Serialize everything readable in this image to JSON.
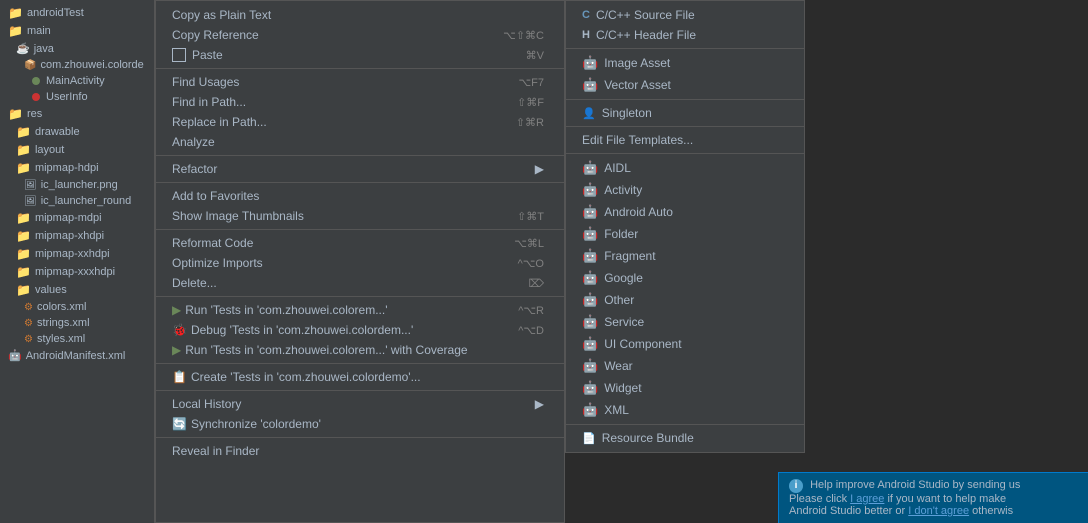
{
  "sidebar": {
    "items": [
      {
        "label": "androidTest",
        "indent": 0,
        "type": "folder"
      },
      {
        "label": "main",
        "indent": 0,
        "type": "folder"
      },
      {
        "label": "java",
        "indent": 1,
        "type": "folder"
      },
      {
        "label": "com.zhouwei.colorde",
        "indent": 2,
        "type": "package"
      },
      {
        "label": "MainActivity",
        "indent": 3,
        "type": "class-green"
      },
      {
        "label": "UserInfo",
        "indent": 3,
        "type": "class-red"
      },
      {
        "label": "res",
        "indent": 0,
        "type": "folder"
      },
      {
        "label": "drawable",
        "indent": 1,
        "type": "folder"
      },
      {
        "label": "layout",
        "indent": 1,
        "type": "folder"
      },
      {
        "label": "mipmap-hdpi",
        "indent": 1,
        "type": "folder"
      },
      {
        "label": "ic_launcher.png",
        "indent": 2,
        "type": "file"
      },
      {
        "label": "ic_launcher_round",
        "indent": 2,
        "type": "file"
      },
      {
        "label": "mipmap-mdpi",
        "indent": 1,
        "type": "folder"
      },
      {
        "label": "mipmap-xhdpi",
        "indent": 1,
        "type": "folder"
      },
      {
        "label": "mipmap-xxhdpi",
        "indent": 1,
        "type": "folder"
      },
      {
        "label": "mipmap-xxxhdpi",
        "indent": 1,
        "type": "folder"
      },
      {
        "label": "values",
        "indent": 1,
        "type": "folder"
      },
      {
        "label": "colors.xml",
        "indent": 2,
        "type": "xml"
      },
      {
        "label": "strings.xml",
        "indent": 2,
        "type": "xml"
      },
      {
        "label": "styles.xml",
        "indent": 2,
        "type": "xml"
      },
      {
        "label": "AndroidManifest.xml",
        "indent": 0,
        "type": "android"
      }
    ]
  },
  "left_menu": {
    "items": [
      {
        "label": "Copy as Plain Text",
        "shortcut": "",
        "type": "item"
      },
      {
        "label": "Copy Reference",
        "shortcut": "⌥⇧⌘C",
        "type": "item"
      },
      {
        "label": "Paste",
        "shortcut": "⌘V",
        "type": "item-icon",
        "icon": "paste"
      },
      {
        "separator": true
      },
      {
        "label": "Find Usages",
        "shortcut": "⌥F7",
        "type": "item"
      },
      {
        "label": "Find in Path...",
        "shortcut": "⇧⌘F",
        "type": "item"
      },
      {
        "label": "Replace in Path...",
        "shortcut": "⇧⌘R",
        "type": "item"
      },
      {
        "label": "Analyze",
        "shortcut": "",
        "type": "item"
      },
      {
        "separator": true
      },
      {
        "label": "Refactor",
        "shortcut": "",
        "type": "item",
        "arrow": true
      },
      {
        "separator": true
      },
      {
        "label": "Add to Favorites",
        "shortcut": "",
        "type": "item"
      },
      {
        "label": "Show Image Thumbnails",
        "shortcut": "⇧⌘T",
        "type": "item"
      },
      {
        "separator": true
      },
      {
        "label": "Reformat Code",
        "shortcut": "⌥⌘L",
        "type": "item"
      },
      {
        "label": "Optimize Imports",
        "shortcut": "^⌥O",
        "type": "item"
      },
      {
        "label": "Delete...",
        "shortcut": "⌦",
        "type": "item"
      },
      {
        "separator": true
      },
      {
        "label": "Run 'Tests in 'com.zhouwei.colorem...'",
        "shortcut": "^⌥R",
        "type": "item-run"
      },
      {
        "label": "Debug 'Tests in 'com.zhouwei.colordem...'",
        "shortcut": "^⌥D",
        "type": "item-debug"
      },
      {
        "label": "Run 'Tests in 'com.zhouwei.colorem...' with Coverage",
        "shortcut": "",
        "type": "item-run"
      },
      {
        "separator": true
      },
      {
        "label": "Create 'Tests in 'com.zhouwei.colordemo'...",
        "shortcut": "",
        "type": "item-create"
      },
      {
        "separator": true
      },
      {
        "label": "Local History",
        "shortcut": "",
        "type": "item",
        "arrow": true
      },
      {
        "label": "Synchronize 'colordemo'",
        "shortcut": "",
        "type": "item-sync"
      },
      {
        "separator": true
      },
      {
        "label": "Reveal in Finder",
        "shortcut": "",
        "type": "item"
      }
    ]
  },
  "right_submenu": {
    "items": [
      {
        "label": "C/C++ Source File",
        "type": "cpp"
      },
      {
        "label": "C/C++ Header File",
        "type": "header"
      },
      {
        "separator": true
      },
      {
        "label": "Image Asset",
        "type": "android"
      },
      {
        "label": "Vector Asset",
        "type": "android"
      },
      {
        "separator": true
      },
      {
        "label": "Singleton",
        "type": "person"
      },
      {
        "separator": true
      },
      {
        "label": "Edit File Templates...",
        "type": "plain"
      },
      {
        "separator": true
      },
      {
        "label": "AIDL",
        "type": "android"
      },
      {
        "label": "Activity",
        "type": "android"
      },
      {
        "label": "Android Auto",
        "type": "android"
      },
      {
        "label": "Folder",
        "type": "android"
      },
      {
        "label": "Fragment",
        "type": "android"
      },
      {
        "label": "Google",
        "type": "android"
      },
      {
        "label": "Other",
        "type": "android"
      },
      {
        "label": "Service",
        "type": "android"
      },
      {
        "label": "UI Component",
        "type": "android"
      },
      {
        "label": "Wear",
        "type": "android"
      },
      {
        "label": "Widget",
        "type": "android"
      },
      {
        "label": "XML",
        "type": "android"
      },
      {
        "separator": true
      },
      {
        "label": "Resource Bundle",
        "type": "file"
      }
    ]
  },
  "notification": {
    "title": "Help improve Android Studio by sending us",
    "line2": "Please click ",
    "agree_link": "I agree",
    "middle": " if you want to help make",
    "line3": "Android Studio better or ",
    "disagree_link": "I don't agree",
    "end": " otherwis"
  }
}
